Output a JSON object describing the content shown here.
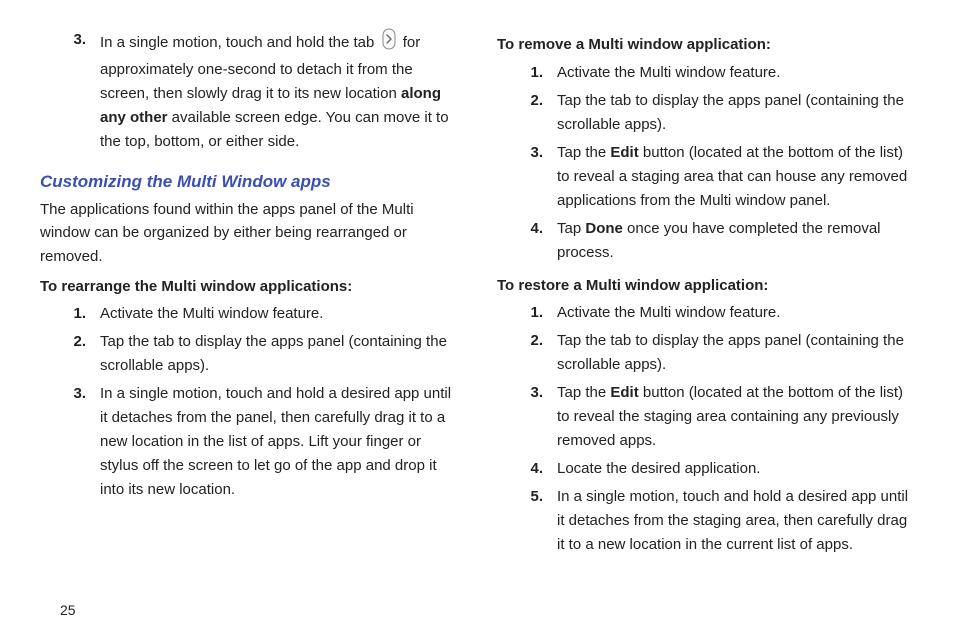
{
  "page_number": "25",
  "left": {
    "step3_pre": "In a single motion, touch and hold the tab",
    "step3_post_a": " for approximately one-second to detach it from the screen, then slowly drag it to its new location ",
    "step3_bold": "along any other",
    "step3_post_b": " available screen edge. You can move it to the top, bottom, or either side.",
    "step3_num": "3.",
    "heading": "Customizing the Multi Window apps",
    "intro": "The applications found within the apps panel of the Multi window can be organized by either being rearranged or removed.",
    "sub1": "To rearrange the Multi window applications:",
    "s1_num": "1.",
    "s1": "Activate the Multi window feature.",
    "s2_num": "2.",
    "s2": "Tap the tab to display the apps panel (containing the scrollable apps).",
    "s3_num": "3.",
    "s3": "In a single motion, touch and hold a desired app until it detaches from the panel, then carefully drag it to a new location in the list of apps. Lift your finger or stylus off the screen to let go of the app and drop it into its new location."
  },
  "right": {
    "sub1": "To remove a Multi window application:",
    "r1_num": "1.",
    "r1": "Activate the Multi window feature.",
    "r2_num": "2.",
    "r2": "Tap the tab to display the apps panel (containing the scrollable apps).",
    "r3_num": "3.",
    "r3_a": "Tap the ",
    "r3_b": "Edit",
    "r3_c": " button (located at the bottom of the list) to reveal a staging area that can house any removed applications from the Multi window panel.",
    "r4_num": "4.",
    "r4_a": "Tap ",
    "r4_b": "Done",
    "r4_c": " once you have completed the removal process.",
    "sub2": "To restore a Multi window application:",
    "q1_num": "1.",
    "q1": "Activate the Multi window feature.",
    "q2_num": "2.",
    "q2": "Tap the tab to display the apps panel (containing the scrollable apps).",
    "q3_num": "3.",
    "q3_a": "Tap the ",
    "q3_b": "Edit",
    "q3_c": " button (located at the bottom of the list) to reveal the staging area containing any previously removed apps.",
    "q4_num": "4.",
    "q4": "Locate the desired application.",
    "q5_num": "5.",
    "q5": "In a single motion, touch and hold a desired app until it detaches from the staging area, then carefully drag it to a new location in the current list of apps."
  }
}
